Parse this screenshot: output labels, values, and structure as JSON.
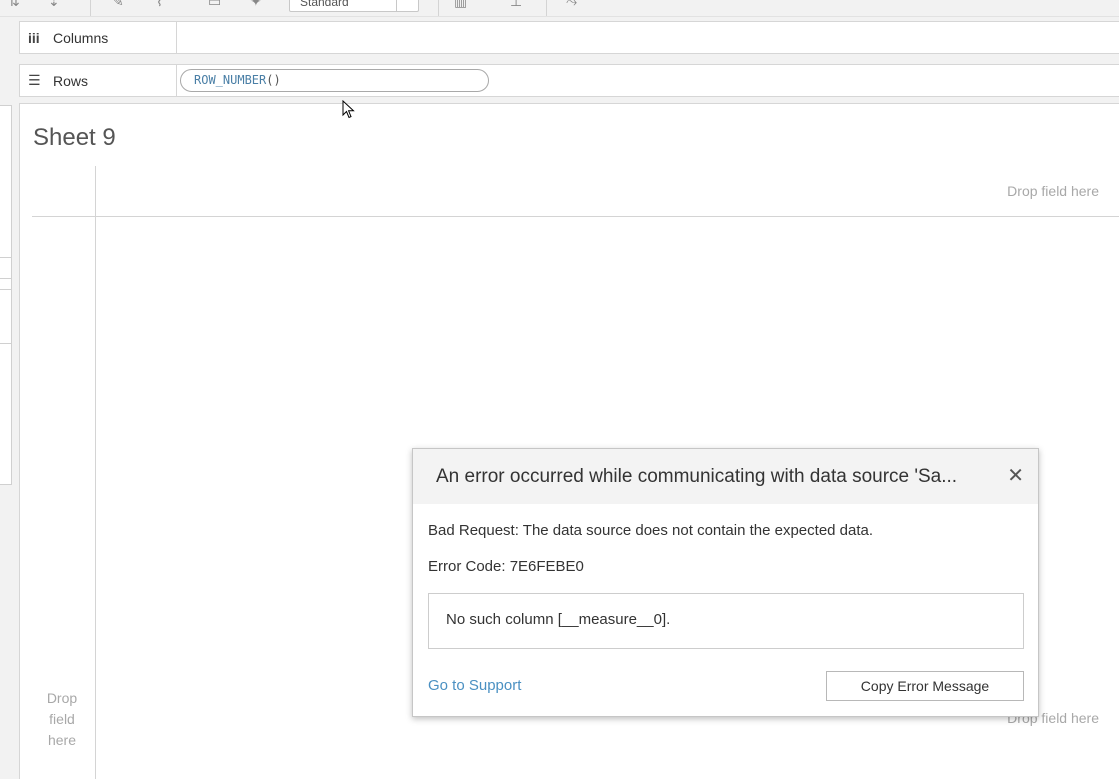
{
  "toolbar": {
    "fit_dropdown_value": "Standard"
  },
  "shelves": {
    "columns_label": "Columns",
    "rows_label": "Rows",
    "rows_pill": {
      "name": "ROW_NUMBER",
      "parens": "()"
    }
  },
  "canvas": {
    "sheet_title": "Sheet 9",
    "drop_field_columns": "Drop field here",
    "drop_field_rows": "Drop field here",
    "drop_field_bottom": "Drop field here"
  },
  "error_dialog": {
    "title": "An error occurred while communicating with data source 'Sa...",
    "message": "Bad Request: The data source does not contain the expected data.",
    "error_code": "Error Code: 7E6FEBE0",
    "detail": "No such column [__measure__0].",
    "support_link": "Go to Support",
    "copy_button": "Copy Error Message"
  }
}
